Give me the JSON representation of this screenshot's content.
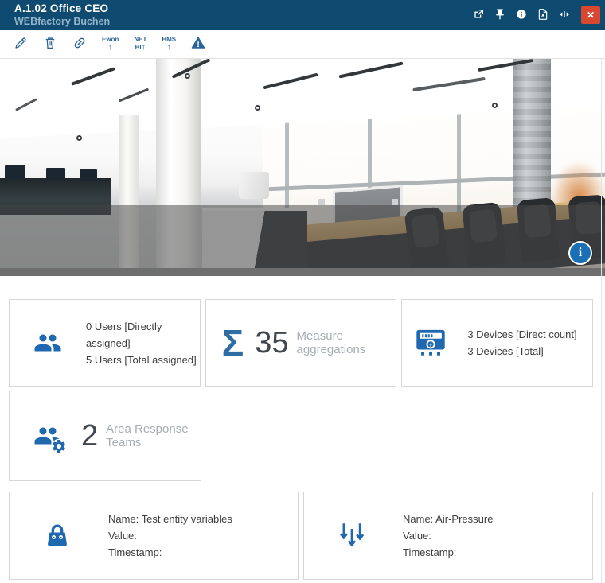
{
  "header": {
    "title": "A.1.02 Office CEO",
    "subtitle": "WEBfactory Buchen",
    "close_glyph": "✕",
    "actions": [
      {
        "name": "open-external-icon"
      },
      {
        "name": "pin-icon"
      },
      {
        "name": "info-icon"
      },
      {
        "name": "export-pdf-icon"
      },
      {
        "name": "resize-horizontal-icon"
      },
      {
        "name": "close-icon"
      }
    ]
  },
  "toolbar": {
    "icons": [
      "edit-icon",
      "delete-icon",
      "link-icon",
      "ewon-upload",
      "netbi-upload",
      "hms-upload",
      "warning-icon"
    ],
    "ewon_label": "Ewon",
    "netbi_label_line1": "NET",
    "netbi_label_line2": "BI",
    "hms_label": "HMS",
    "upload_arrow": "↑"
  },
  "photo": {
    "info_button_glyph": "i"
  },
  "cards": {
    "users": {
      "icon": "users-icon",
      "line1": "0 Users [Directly assigned]",
      "line2": "5 Users [Total assigned]"
    },
    "aggregations": {
      "icon": "sigma-icon",
      "sigma": "Σ",
      "value": "35",
      "label": "Measure aggregations"
    },
    "devices": {
      "icon": "device-meter-icon",
      "line1": "3 Devices [Direct count]",
      "line2": "3 Devices [Total]"
    },
    "teams": {
      "icon": "response-team-icon",
      "value": "2",
      "label": "Area Response Teams"
    },
    "variable_left": {
      "icon": "bag-icon",
      "line1": "Name: Test entity variables",
      "line2": "Value:",
      "line3": "Timestamp:"
    },
    "variable_right": {
      "icon": "pressure-arrows-icon",
      "line1": "Name: Air-Pressure",
      "line2": "Value:",
      "line3": "Timestamp:"
    }
  },
  "colors": {
    "header_bg": "#0f4a70",
    "toolbar_icon_blue": "#2a6496",
    "card_icon_blue": "#2068b0",
    "close_red": "#d9472f",
    "number_dark": "#41474e",
    "label_gray": "#a7adb4"
  }
}
